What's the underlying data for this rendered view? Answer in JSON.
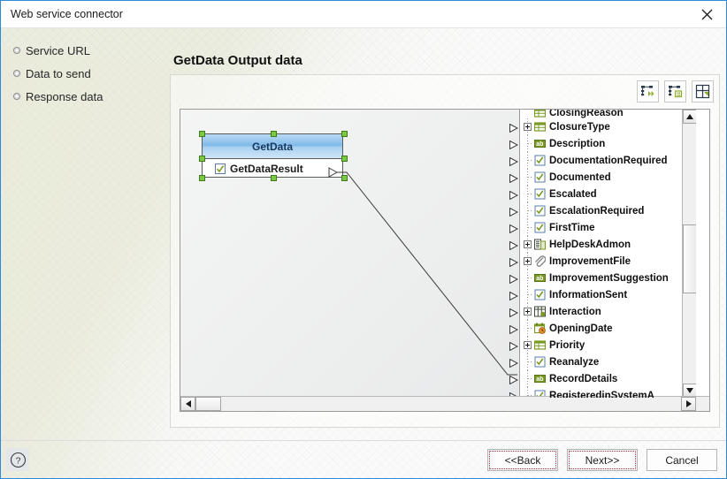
{
  "window": {
    "title": "Web service connector",
    "close_icon": "close-icon"
  },
  "sidebar": {
    "items": [
      {
        "label": "Service URL",
        "icon": "radio-bullet-icon"
      },
      {
        "label": "Data to send",
        "icon": "radio-bullet-icon"
      },
      {
        "label": "Response data",
        "icon": "radio-bullet-icon"
      }
    ]
  },
  "main": {
    "page_title": "GetData Output data",
    "toolbar": [
      {
        "name": "auto-layout-button",
        "icon": "tree-arrow-icon",
        "title": "Auto layout"
      },
      {
        "name": "show-properties-button",
        "icon": "tree-properties-icon",
        "title": "Properties"
      },
      {
        "name": "fit-to-window-button",
        "icon": "fit-window-icon",
        "title": "Fit to window"
      }
    ]
  },
  "canvas": {
    "node": {
      "title": "GetData",
      "row_label": "GetDataResult",
      "row_icon": "checkbox-icon",
      "selected": true,
      "handle_color": "#7ac943",
      "header_color": "#7fb8e8"
    },
    "tree": {
      "clipped_top_label": "ClosingReason",
      "items": [
        {
          "label": "ClosureType",
          "icon": "table-icon",
          "expandable": true
        },
        {
          "label": "Description",
          "icon": "ab-text-icon",
          "expandable": false
        },
        {
          "label": "DocumentationRequired",
          "icon": "checkbox-icon",
          "expandable": false
        },
        {
          "label": "Documented",
          "icon": "checkbox-icon",
          "expandable": false
        },
        {
          "label": "Escalated",
          "icon": "checkbox-icon",
          "expandable": false
        },
        {
          "label": "EscalationRequired",
          "icon": "checkbox-icon",
          "expandable": false
        },
        {
          "label": "FirstTime",
          "icon": "checkbox-icon",
          "expandable": false
        },
        {
          "label": "HelpDeskAdmon",
          "icon": "entity-icon",
          "expandable": true
        },
        {
          "label": "ImprovementFile",
          "icon": "paperclip-icon",
          "expandable": true
        },
        {
          "label": "ImprovementSuggestion",
          "icon": "ab-text-icon",
          "expandable": false
        },
        {
          "label": "InformationSent",
          "icon": "checkbox-icon",
          "expandable": false
        },
        {
          "label": "Interaction",
          "icon": "grid-entity-icon",
          "expandable": true
        },
        {
          "label": "OpeningDate",
          "icon": "calendar-clock-icon",
          "expandable": false
        },
        {
          "label": "Priority",
          "icon": "table-icon",
          "expandable": true
        },
        {
          "label": "Reanalyze",
          "icon": "checkbox-icon",
          "expandable": false
        },
        {
          "label": "RecordDetails",
          "icon": "ab-text-icon",
          "expandable": false
        },
        {
          "label": "RegisteredinSystemA",
          "icon": "checkbox-icon",
          "expandable": false
        }
      ]
    },
    "scroll": {
      "vertical_icon_up": "scroll-up-icon",
      "vertical_icon_down": "scroll-down-icon",
      "horizontal_icon_left": "scroll-left-icon",
      "horizontal_icon_right": "scroll-right-icon"
    }
  },
  "footer": {
    "help_icon": "help-icon",
    "buttons": [
      {
        "label": "<<Back",
        "name": "back-button",
        "focused": true
      },
      {
        "label": "Next>>",
        "name": "next-button",
        "focused": true
      },
      {
        "label": "Cancel",
        "name": "cancel-button",
        "focused": false
      }
    ]
  },
  "colors": {
    "accent": "#2e8ad8",
    "node_header": "#7fb8e8",
    "handle_green": "#7ac943",
    "icon_green": "#7a9a24"
  }
}
